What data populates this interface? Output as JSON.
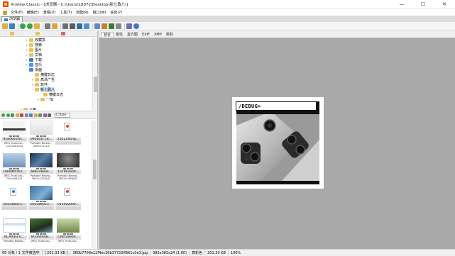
{
  "window": {
    "title": "XnView Classic - [浏览器 - C:\\Users\\18072\\Desktop\\新七致八\\]",
    "min": "—",
    "max": "☐",
    "close": "✕"
  },
  "menu": [
    "文件(F)",
    "编辑(E)",
    "查看(V)",
    "工具(T)",
    "创建(R)",
    "窗口(W)",
    "信息(?)"
  ],
  "doc_tab": "浏览器",
  "tree": [
    {
      "label": "收藏夹",
      "icon": "folder-icon"
    },
    {
      "label": "搜索",
      "icon": "folder-icon"
    },
    {
      "label": "图片",
      "icon": "folder-icon"
    },
    {
      "label": "文档",
      "icon": "folder-icon"
    },
    {
      "label": "下载",
      "icon": "download-icon"
    },
    {
      "label": "音乐",
      "icon": "music-icon"
    },
    {
      "label": "桌面",
      "icon": "desktop-icon"
    },
    {
      "label": "横键日志",
      "icon": "folder-icon"
    },
    {
      "label": "高清广告",
      "icon": "folder-icon"
    },
    {
      "label": "软件",
      "icon": "folder-icon"
    },
    {
      "label": "新七致八",
      "icon": "folder-icon"
    },
    {
      "label": "横键日志",
      "icon": "folder-icon"
    },
    {
      "label": "一加",
      "icon": "folder-icon"
    },
    {
      "label": "公用",
      "icon": "folder-icon"
    }
  ],
  "path_combo": "C:\\Use",
  "thumbnails": [
    {
      "name": "918d601f4c...",
      "meta1": "JPEG TrueColo...",
      "meta2": "1125x281x24"
    },
    {
      "name": "995801FC8...",
      "meta1": "Portable Netwo...",
      "meta2": "300x271x24"
    },
    {
      "name": "2021Zhong...",
      "meta1": "",
      "meta2": ""
    },
    {
      "name": "16604fa762...",
      "meta1": "JPEG TrueColo...",
      "meta2": "700x494x24"
    },
    {
      "name": "48831be0e...",
      "meta1": "Portable Netwo...",
      "meta2": "1802x1258x32"
    },
    {
      "name": "107902e00...",
      "meta1": "Portable Netwo...",
      "meta2": "1802x1568x32"
    },
    {
      "name": "835388313...",
      "meta1": "",
      "meta2": ""
    },
    {
      "name": "835388313...",
      "meta1": "",
      "meta2": ""
    },
    {
      "name": "011002000...",
      "meta1": "",
      "meta2": ""
    },
    {
      "name": "BCAA4EF0...",
      "meta1": "Portable Netwo...",
      "meta2": ""
    },
    {
      "name": "BC6A4A48...",
      "meta1": "JPEG TrueColo...",
      "meta2": ""
    },
    {
      "name": "c3bff28e6d...",
      "meta1": "JPEG TrueColo...",
      "meta2": ""
    }
  ],
  "right_tabs": [
    "预览",
    "属性",
    "直方图",
    "EXIF",
    "XMP",
    "类别"
  ],
  "preview": {
    "debug_label": "/DEBUG>"
  },
  "status": {
    "count": "65 对象 / 1 文件被选中",
    "size": "[ 201.33 KB ]",
    "file": "360b7708a12f4ec36b37722ff661c0e3.jpg",
    "dims": "383x383x24 (1.00)",
    "color": "真彩色",
    "filesize": "201.33 KB",
    "zoom": "100%"
  }
}
